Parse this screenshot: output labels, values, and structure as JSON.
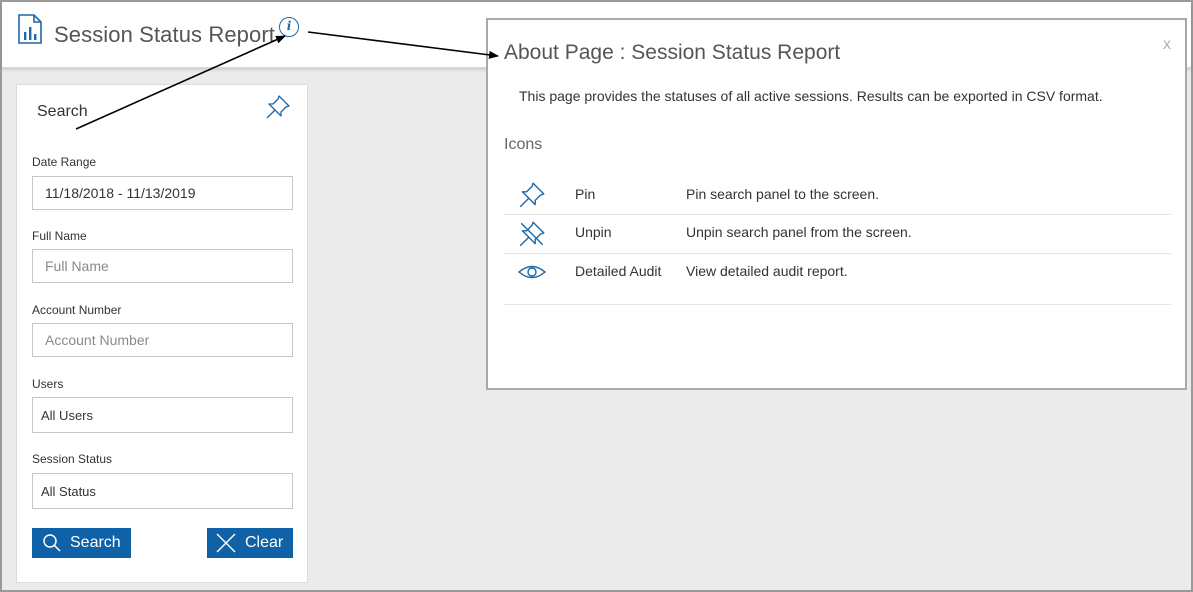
{
  "header": {
    "title": "Session Status Report",
    "icon": "bar-chart-icon",
    "info_icon_glyph": "i"
  },
  "search_panel": {
    "title": "Search",
    "fields": {
      "date_range": {
        "label": "Date Range",
        "value": "11/18/2018 - 11/13/2019"
      },
      "full_name": {
        "label": "Full Name",
        "placeholder": "Full Name"
      },
      "account_number": {
        "label": "Account Number",
        "placeholder": "Account Number"
      },
      "users": {
        "label": "Users",
        "value": "All Users"
      },
      "session_status": {
        "label": "Session Status",
        "value": "All Status"
      }
    },
    "buttons": {
      "search": "Search",
      "clear": "Clear"
    }
  },
  "modal": {
    "title": "About Page : Session Status Report",
    "close": "x",
    "description": "This page provides the statuses of all active sessions. Results can be exported in CSV format.",
    "icons_heading": "Icons",
    "icons": [
      {
        "icon": "pin-icon",
        "name": "Pin",
        "description": "Pin search panel to the screen."
      },
      {
        "icon": "unpin-icon",
        "name": "Unpin",
        "description": "Unpin search panel from the screen."
      },
      {
        "icon": "eye-icon",
        "name": "Detailed Audit",
        "description": "View detailed audit report."
      }
    ]
  },
  "colors": {
    "accent": "#0f62a8",
    "icon_blue": "#1f67a8",
    "background": "#ebebeb",
    "annotation": "#000000"
  }
}
